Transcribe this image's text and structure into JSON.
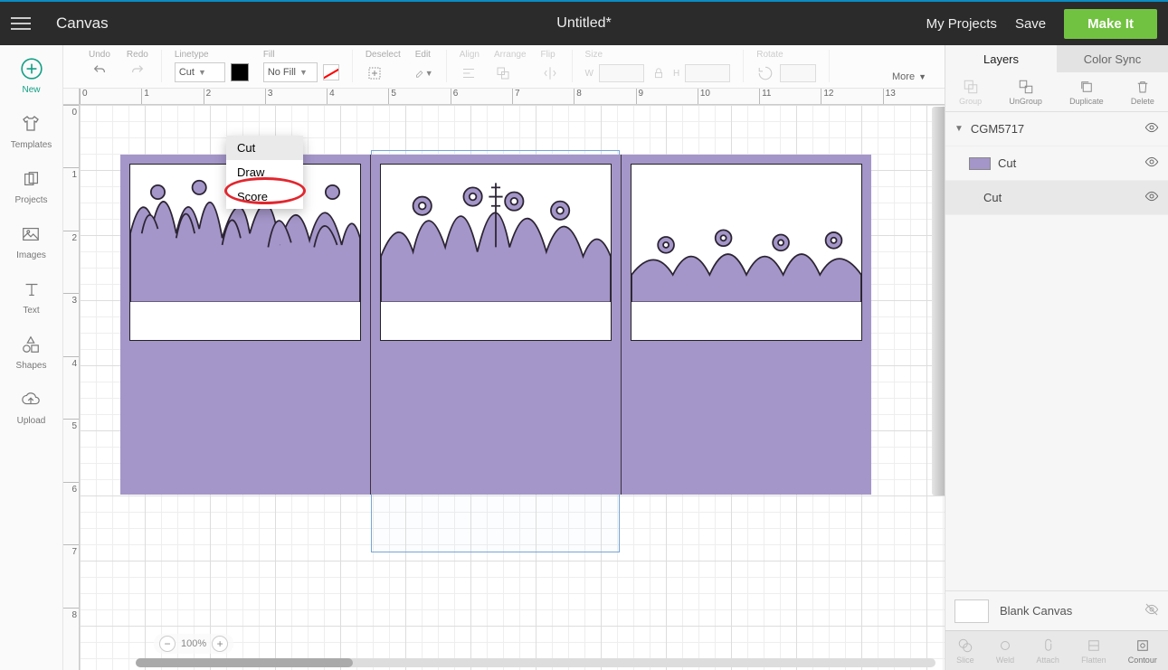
{
  "topbar": {
    "app_area": "Canvas",
    "doc_title": "Untitled*",
    "my_projects": "My Projects",
    "save": "Save",
    "make_it": "Make It"
  },
  "left_sidebar": {
    "new": "New",
    "templates": "Templates",
    "projects": "Projects",
    "images": "Images",
    "text": "Text",
    "shapes": "Shapes",
    "upload": "Upload"
  },
  "toolbar": {
    "undo": "Undo",
    "redo": "Redo",
    "linetype_label": "Linetype",
    "linetype_value": "Cut",
    "fill_label": "Fill",
    "fill_value": "No Fill",
    "deselect": "Deselect",
    "edit": "Edit",
    "align": "Align",
    "arrange": "Arrange",
    "flip": "Flip",
    "size": "Size",
    "w": "W",
    "h": "H",
    "rotate": "Rotate",
    "more": "More"
  },
  "linetype_menu": {
    "cut": "Cut",
    "draw": "Draw",
    "score": "Score"
  },
  "ruler_h": [
    "0",
    "1",
    "2",
    "3",
    "4",
    "5",
    "6",
    "7",
    "8",
    "9",
    "10",
    "11",
    "12",
    "13"
  ],
  "ruler_v": [
    "0",
    "1",
    "2",
    "3",
    "4",
    "5",
    "6",
    "7",
    "8"
  ],
  "zoom": {
    "value": "100%"
  },
  "right_panel": {
    "tab_layers": "Layers",
    "tab_colorsync": "Color Sync",
    "tools": {
      "group": "Group",
      "ungroup": "UnGroup",
      "duplicate": "Duplicate",
      "delete": "Delete"
    },
    "layers": {
      "root": "CGM5717",
      "child1": "Cut",
      "child2": "Cut"
    },
    "blank_canvas": "Blank Canvas",
    "bottom": {
      "slice": "Slice",
      "weld": "Weld",
      "attach": "Attach",
      "flatten": "Flatten",
      "contour": "Contour"
    }
  },
  "colors": {
    "shape_fill": "#a496c8"
  }
}
